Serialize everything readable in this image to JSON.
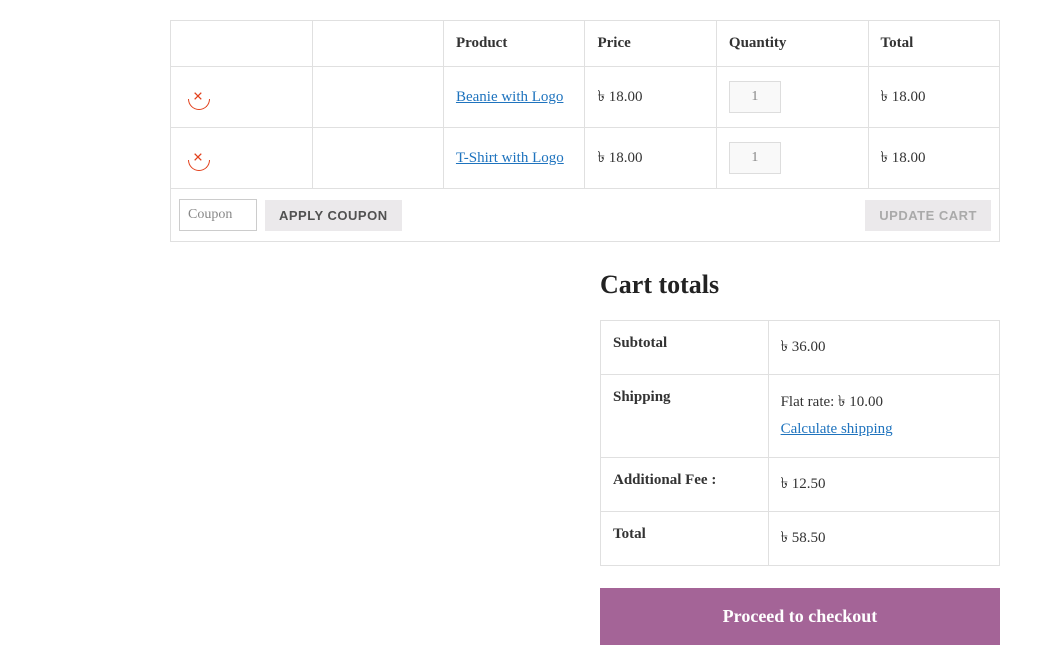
{
  "headers": {
    "product": "Product",
    "price": "Price",
    "quantity": "Quantity",
    "total": "Total"
  },
  "currency_symbol": "৳ ",
  "items": [
    {
      "name": "Beanie with Logo",
      "price": "৳ 18.00",
      "qty": "1",
      "total": "৳ 18.00"
    },
    {
      "name": "T-Shirt with Logo",
      "price": "৳ 18.00",
      "qty": "1",
      "total": "৳ 18.00"
    }
  ],
  "coupon": {
    "placeholder": "Coupon",
    "apply_label": "APPLY COUPON"
  },
  "update_cart_label": "UPDATE CART",
  "cart_totals": {
    "heading": "Cart totals",
    "subtotal_label": "Subtotal",
    "subtotal_value": "৳ 36.00",
    "shipping_label": "Shipping",
    "shipping_flat_rate": "Flat rate: ৳ 10.00",
    "calculate_shipping": "Calculate shipping",
    "additional_fee_label": "Additional Fee :",
    "additional_fee_value": "৳ 12.50",
    "total_label": "Total",
    "total_value": "৳ 58.50"
  },
  "checkout_label": "Proceed to checkout"
}
